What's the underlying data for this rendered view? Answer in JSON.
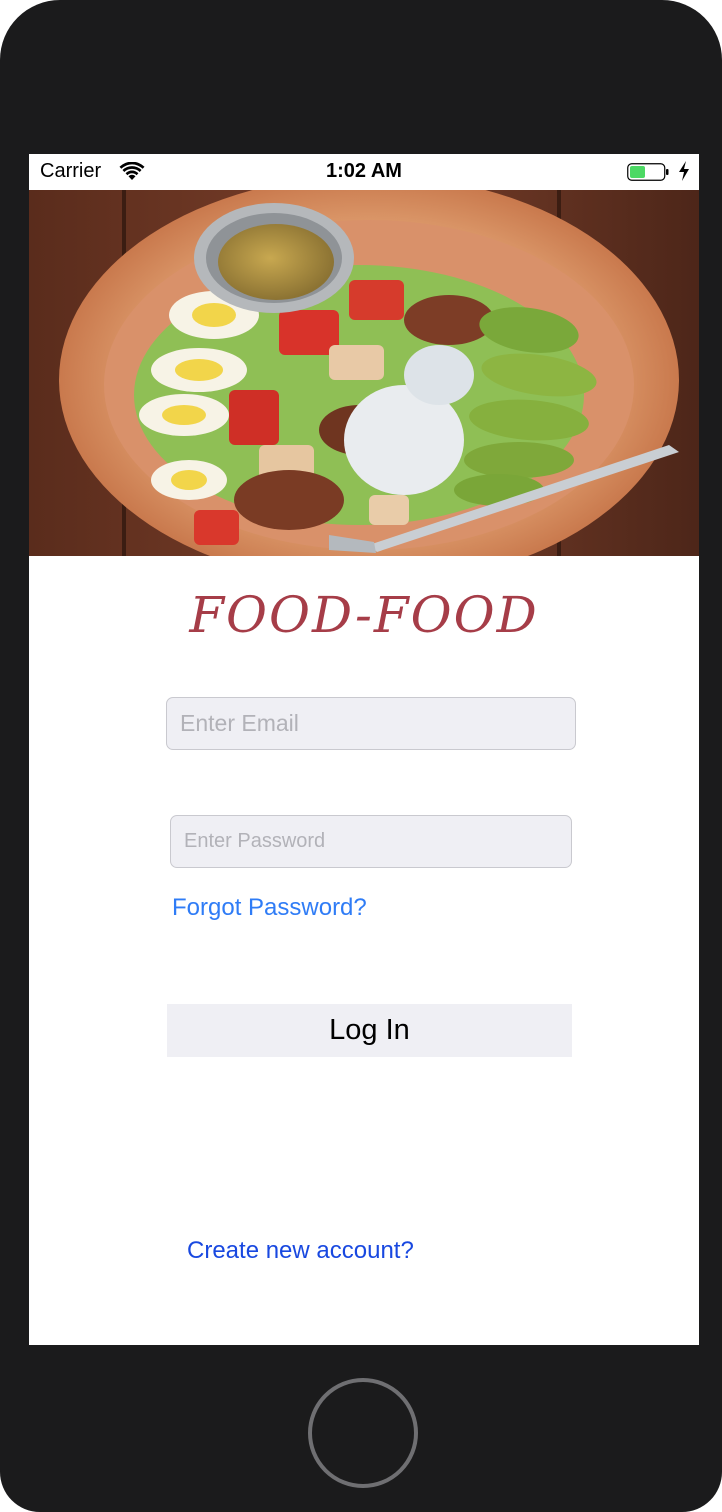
{
  "status_bar": {
    "carrier": "Carrier",
    "time": "1:02 AM",
    "wifi_icon": "wifi-icon",
    "battery_icon": "battery-charging-icon"
  },
  "hero": {
    "image": "salad-bowl-photo"
  },
  "app": {
    "title": "FOOD-FOOD",
    "title_color": "#a63d48"
  },
  "login_form": {
    "email_placeholder": "Enter Email",
    "email_value": "",
    "password_placeholder": "Enter Password",
    "password_value": "",
    "forgot_password_label": "Forgot Password?",
    "login_button_label": "Log In",
    "create_account_label": "Create new account?"
  },
  "colors": {
    "link_blue": "#2f7cf6",
    "create_link_blue": "#1848e0",
    "field_background": "#efeff4",
    "device_frame": "#1b1b1c"
  }
}
